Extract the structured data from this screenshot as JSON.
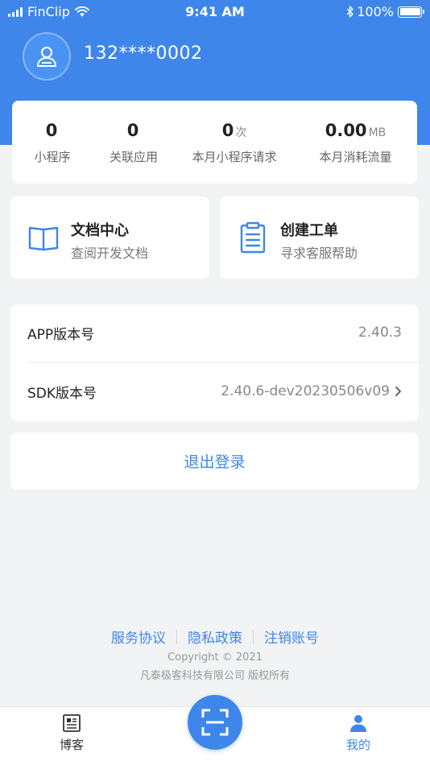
{
  "status_bar": {
    "carrier": "FinClip",
    "time": "9:41 AM",
    "battery": "100%",
    "battery_level": 1.0
  },
  "user": {
    "phone": "132****0002"
  },
  "stats": [
    {
      "value": "0",
      "unit": "",
      "label": "小程序"
    },
    {
      "value": "0",
      "unit": "",
      "label": "关联应用"
    },
    {
      "value": "0",
      "unit": "次",
      "label": "本月小程序请求"
    },
    {
      "value": "0.00",
      "unit": "MB",
      "label": "本月消耗流量"
    }
  ],
  "links": {
    "docs": {
      "title": "文档中心",
      "subtitle": "查阅开发文档",
      "icon": "book-icon"
    },
    "ticket": {
      "title": "创建工单",
      "subtitle": "寻求客服帮助",
      "icon": "clipboard-icon"
    }
  },
  "versions": {
    "app": {
      "label": "APP版本号",
      "value": "2.40.3"
    },
    "sdk": {
      "label": "SDK版本号",
      "value": "2.40.6-dev20230506v09"
    }
  },
  "logout": {
    "label": "退出登录"
  },
  "footer": {
    "links": [
      "服务协议",
      "隐私政策",
      "注销账号"
    ],
    "copyright": "Copyright © 2021",
    "company": "凡泰极客科技有限公司 版权所有"
  },
  "tabs": {
    "blog": {
      "label": "博客",
      "icon": "newspaper-icon"
    },
    "scan": {
      "icon": "scan-icon"
    },
    "mine": {
      "label": "我的",
      "icon": "user-icon"
    }
  },
  "colors": {
    "accent": "#3f86ea",
    "background": "#f2f3f5",
    "inactive_tab": "#333333"
  }
}
